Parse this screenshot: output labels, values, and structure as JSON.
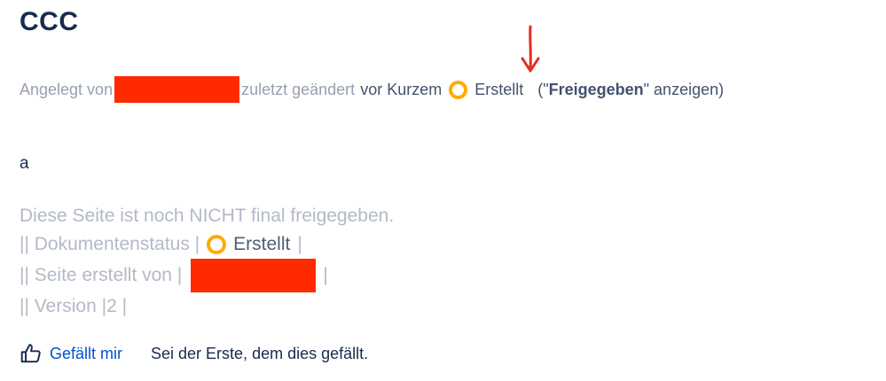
{
  "page": {
    "title": "CCC",
    "paragraph": "a"
  },
  "byline": {
    "created_by_label": "Angelegt von",
    "modified_label": "zuletzt geändert",
    "modified_time": "vor Kurzem",
    "status_label": "Erstellt",
    "show_approved_prefix": "(\"",
    "show_approved_bold": "Freigegeben",
    "show_approved_suffix": "\" anzeigen)"
  },
  "info_block": {
    "line1": "Diese Seite ist noch NICHT final freigegeben.",
    "line2_prefix": "|| Dokumentenstatus |",
    "line2_status": "Erstellt",
    "line2_suffix": "|",
    "line3_prefix": "|| Seite erstellt von |",
    "line3_suffix": "|",
    "line4": "|| Version |2 |"
  },
  "footer": {
    "like_label": "Gefällt mir",
    "like_summary": "Sei der Erste, dem dies gefällt."
  },
  "colors": {
    "status_dot": "#ffab00",
    "redaction": "#ff2a00",
    "annotation_arrow": "#e0301e",
    "link": "#0052cc"
  },
  "icons": {
    "like": "thumbs-up-icon",
    "status": "status-circle-icon",
    "annotation": "red-arrow-down-icon"
  }
}
